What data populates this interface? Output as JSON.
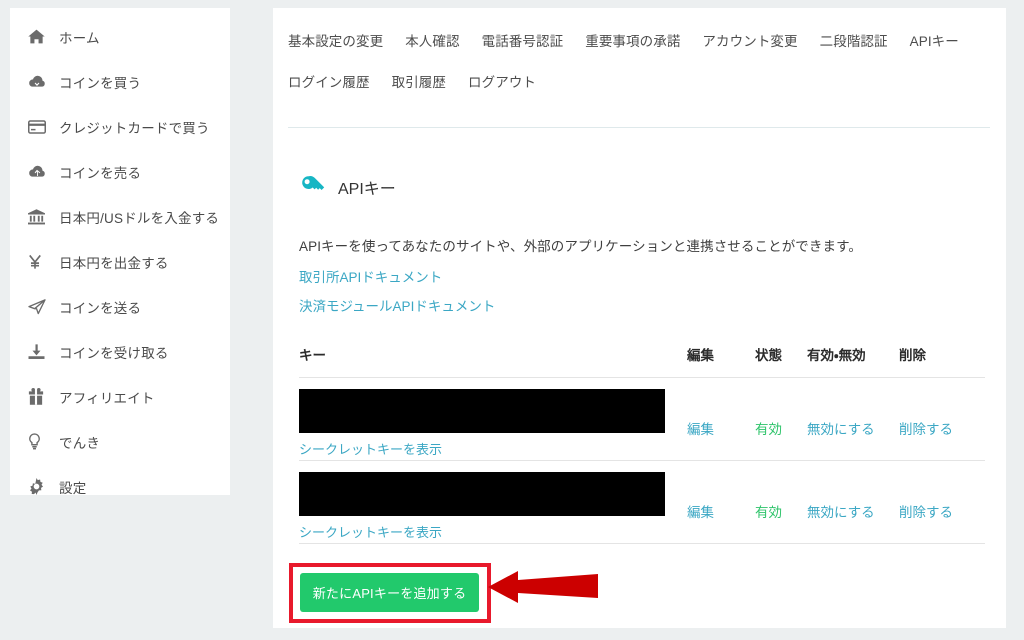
{
  "sidebar": {
    "items": [
      {
        "icon": "home-icon",
        "label": "ホーム"
      },
      {
        "icon": "cloud-download-icon",
        "label": "コインを買う"
      },
      {
        "icon": "credit-card-icon",
        "label": "クレジットカードで買う"
      },
      {
        "icon": "cloud-upload-icon",
        "label": "コインを売る"
      },
      {
        "icon": "bank-icon",
        "label": "日本円/USドルを入金する"
      },
      {
        "icon": "yen-icon",
        "label": "日本円を出金する"
      },
      {
        "icon": "paper-plane-icon",
        "label": "コインを送る"
      },
      {
        "icon": "download-tray-icon",
        "label": "コインを受け取る"
      },
      {
        "icon": "gift-icon",
        "label": "アフィリエイト"
      },
      {
        "icon": "lightbulb-icon",
        "label": "でんき"
      },
      {
        "icon": "gear-icon",
        "label": "設定"
      }
    ]
  },
  "tabs": {
    "row1": [
      "基本設定の変更",
      "本人確認",
      "電話番号認証",
      "重要事項の承諾",
      "アカウント変更",
      "二段階認証",
      "APIキー"
    ],
    "row2": [
      "ログイン履歴",
      "取引履歴",
      "ログアウト"
    ],
    "active": "APIキー"
  },
  "api_section": {
    "icon": "key-icon",
    "title": "APIキー",
    "description": "APIキーを使ってあなたのサイトや、外部のアプリケーションと連携させることができます。",
    "links": [
      "取引所APIドキュメント",
      "決済モジュールAPIドキュメント"
    ]
  },
  "table": {
    "headers": {
      "key": "キー",
      "edit": "編集",
      "state": "状態",
      "toggle": "有効・無効",
      "delete": "削除"
    },
    "rows": [
      {
        "key_value": "",
        "key_redacted": true,
        "secret_link": "シークレットキーを表示",
        "edit": "編集",
        "state": "有効",
        "toggle": "無効にする",
        "delete": "削除する"
      },
      {
        "key_value": "",
        "key_redacted": true,
        "secret_link": "シークレットキーを表示",
        "edit": "編集",
        "state": "有効",
        "toggle": "無効にする",
        "delete": "削除する"
      }
    ]
  },
  "actions": {
    "add_key_label": "新たにAPIキーを追加する"
  },
  "annotation": {
    "highlight_color": "#e8192c",
    "arrow_color": "#cc0000",
    "shape": "arrow-left"
  },
  "colors": {
    "page_background": "#eceff0",
    "panel": "#ffffff",
    "link": "#3ba7c4",
    "success": "#2fc46b",
    "accent": "#17b6c4",
    "button_green": "#22c96c",
    "divider": "#dfe9eb"
  }
}
